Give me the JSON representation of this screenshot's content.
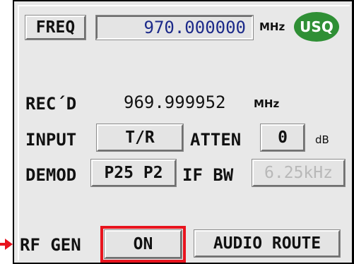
{
  "header": {
    "freq_button": "FREQ",
    "freq_value": "970.000000",
    "freq_unit": "MHz",
    "mode_badge": "USQ"
  },
  "recd": {
    "label": "REC´D",
    "value": "969.999952",
    "unit": "MHz"
  },
  "input": {
    "label": "INPUT",
    "button": "T/R"
  },
  "atten": {
    "label": "ATTEN",
    "value": "0",
    "unit": "dB"
  },
  "demod": {
    "label": "DEMOD",
    "button": "P25 P2"
  },
  "ifbw": {
    "label": "IF BW",
    "button": "6.25kHz"
  },
  "rfgen": {
    "label": "RF GEN",
    "button": "ON"
  },
  "audio_route": {
    "button": "AUDIO ROUTE"
  },
  "colors": {
    "panel": "#e8e8e8",
    "value_text": "#1c2a8a",
    "badge": "#2f8f35",
    "highlight": "#e8141e"
  }
}
